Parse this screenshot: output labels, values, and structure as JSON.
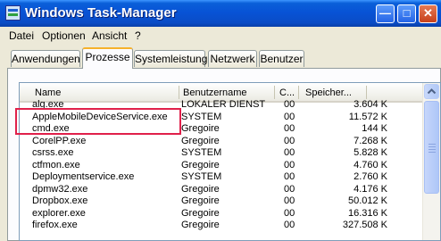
{
  "window": {
    "title": "Windows Task-Manager"
  },
  "menu": [
    "Datei",
    "Optionen",
    "Ansicht",
    "?"
  ],
  "tabs": [
    "Anwendungen",
    "Prozesse",
    "Systemleistung",
    "Netzwerk",
    "Benutzer"
  ],
  "active_tab": "Prozesse",
  "columns": {
    "name": "Name",
    "user": "Benutzername",
    "cpu": "C...",
    "mem": "Speicher..."
  },
  "processes": [
    {
      "name": "alg.exe",
      "user": "LOKALER DIENST",
      "cpu": "00",
      "mem": "3.604 K"
    },
    {
      "name": "AppleMobileDeviceService.exe",
      "user": "SYSTEM",
      "cpu": "00",
      "mem": "11.572 K"
    },
    {
      "name": "cmd.exe",
      "user": "Gregoire",
      "cpu": "00",
      "mem": "144 K"
    },
    {
      "name": "CorelPP.exe",
      "user": "Gregoire",
      "cpu": "00",
      "mem": "7.268 K"
    },
    {
      "name": "csrss.exe",
      "user": "SYSTEM",
      "cpu": "00",
      "mem": "5.828 K"
    },
    {
      "name": "ctfmon.exe",
      "user": "Gregoire",
      "cpu": "00",
      "mem": "4.760 K"
    },
    {
      "name": "Deploymentservice.exe",
      "user": "SYSTEM",
      "cpu": "00",
      "mem": "2.760 K"
    },
    {
      "name": "dpmw32.exe",
      "user": "Gregoire",
      "cpu": "00",
      "mem": "4.176 K"
    },
    {
      "name": "Dropbox.exe",
      "user": "Gregoire",
      "cpu": "00",
      "mem": "50.012 K"
    },
    {
      "name": "explorer.exe",
      "user": "Gregoire",
      "cpu": "00",
      "mem": "16.316 K"
    },
    {
      "name": "firefox.exe",
      "user": "Gregoire",
      "cpu": "00",
      "mem": "327.508 K"
    }
  ],
  "highlighted_process": "AppleMobileDeviceService.exe",
  "colors": {
    "highlight": "#e0204a",
    "titlebar": "#0a5fd8"
  }
}
